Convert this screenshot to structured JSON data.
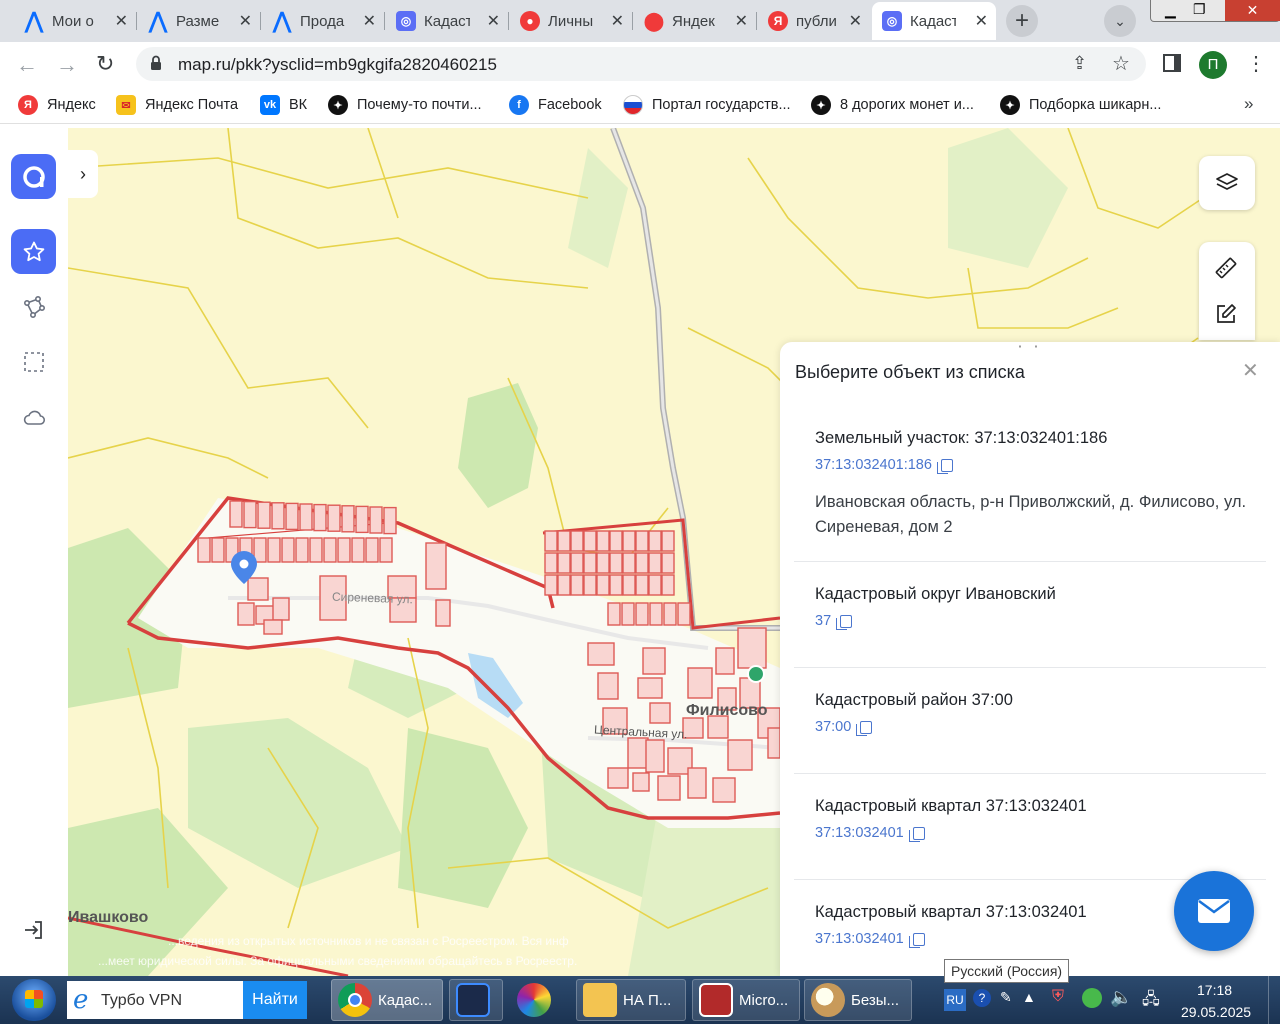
{
  "tabs": [
    {
      "label": "Мои о",
      "icon": "avito-icon",
      "color": "#0a6cff"
    },
    {
      "label": "Разме",
      "icon": "avito-icon",
      "color": "#0a6cff"
    },
    {
      "label": "Прода",
      "icon": "avito-icon",
      "color": "#0a6cff"
    },
    {
      "label": "Кадаст",
      "icon": "pkk-icon",
      "color": "#5b6ef5"
    },
    {
      "label": "Личны",
      "icon": "red-circle-icon",
      "color": "#f03a3a"
    },
    {
      "label": "Яндек",
      "icon": "map-pin-icon",
      "color": "#f03a3a"
    },
    {
      "label": "публи",
      "icon": "yandex-icon",
      "color": "#f03a3a"
    },
    {
      "label": "Кадаст",
      "icon": "pkk-icon",
      "color": "#5b6ef5"
    }
  ],
  "new_tab_label": "+",
  "address": {
    "url": "map.ru/pkk?ysclid=mb9gkgifa2820460215"
  },
  "profile_initial": "П",
  "bookmarks": [
    {
      "label": "Яндекс",
      "icon": "yandex-icon"
    },
    {
      "label": "Яндекс Почта",
      "icon": "mail-icon"
    },
    {
      "label": "ВК",
      "icon": "vk-icon"
    },
    {
      "label": "Почему-то почти...",
      "icon": "zen-icon"
    },
    {
      "label": "Facebook",
      "icon": "facebook-icon"
    },
    {
      "label": "Портал государств...",
      "icon": "gosuslugi-icon"
    },
    {
      "label": "8 дорогих монет и...",
      "icon": "zen-icon"
    },
    {
      "label": "Подборка шикарн...",
      "icon": "zen-icon"
    }
  ],
  "bookmarks_more": "»",
  "map": {
    "street_1": "Сиреневая ул.",
    "street_2": "Центральная ул.",
    "village_1": "Филисово",
    "village_2": "Ивашково",
    "disclaimer_1": "...ведения из открытых источников и не связан с Росреестром. Вся инф",
    "disclaimer_2": "...меет юридической силы. За официальными сведениями обращайтесь в Росреестр."
  },
  "panel": {
    "title": "Выберите объект из списка",
    "results": [
      {
        "title": "Земельный участок: 37:13:032401:186",
        "number": "37:13:032401:186",
        "address": "Ивановская область, р-н Приволжский, д. Филисово, ул. Сиреневая, дом 2"
      },
      {
        "title": "Кадастровый округ Ивановский",
        "number": "37"
      },
      {
        "title": "Кадастровый район 37:00",
        "number": "37:00"
      },
      {
        "title": "Кадастровый квартал 37:13:032401",
        "number": "37:13:032401"
      },
      {
        "title": "Кадастровый квартал 37:13:032401",
        "number": "37:13:032401"
      }
    ]
  },
  "taskbar": {
    "search_placeholder": "Турбо VPN",
    "search_button": "Найти",
    "apps": [
      {
        "label": "Кадас..."
      },
      {
        "label": ""
      },
      {
        "label": ""
      },
      {
        "label": "НА П..."
      },
      {
        "label": "Micro..."
      },
      {
        "label": "Безы..."
      }
    ],
    "lang": "RU",
    "lang_tooltip": "Русский (Россия)",
    "time": "17:18",
    "date": "29.05.2025"
  }
}
